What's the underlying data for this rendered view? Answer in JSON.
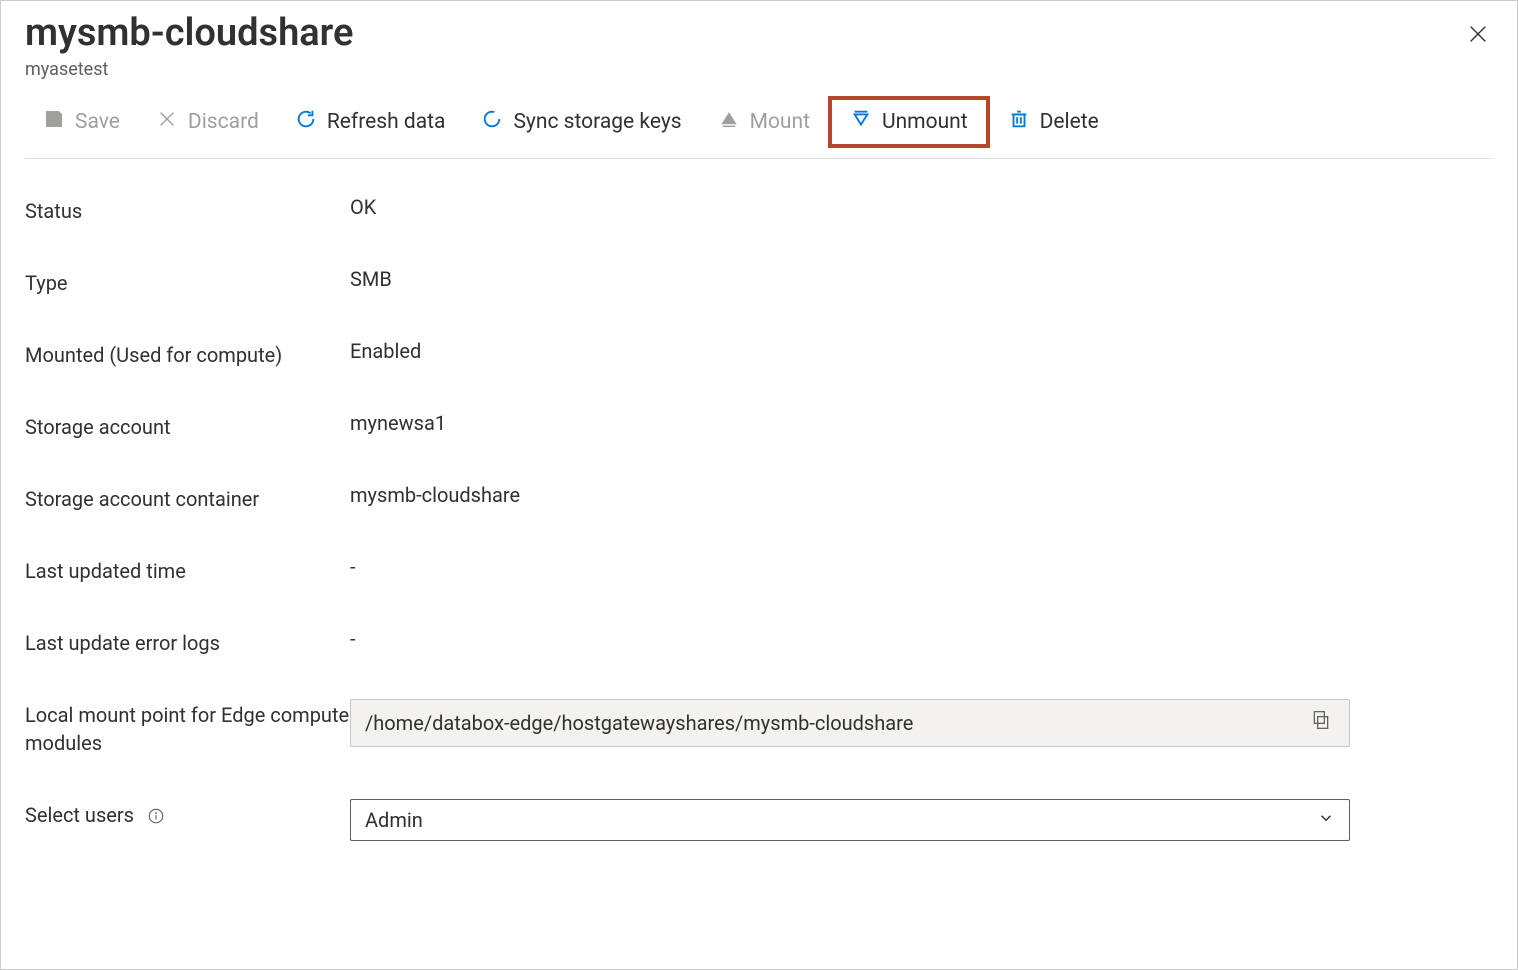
{
  "header": {
    "title": "mysmb-cloudshare",
    "subtitle": "myasetest"
  },
  "toolbar": {
    "save": "Save",
    "discard": "Discard",
    "refresh": "Refresh data",
    "sync": "Sync storage keys",
    "mount": "Mount",
    "unmount": "Unmount",
    "delete": "Delete"
  },
  "props": {
    "status": {
      "label": "Status",
      "value": "OK"
    },
    "type": {
      "label": "Type",
      "value": "SMB"
    },
    "mounted": {
      "label": "Mounted (Used for compute)",
      "value": "Enabled"
    },
    "storage_account": {
      "label": "Storage account",
      "value": "mynewsa1"
    },
    "container": {
      "label": "Storage account container",
      "value": "mysmb-cloudshare"
    },
    "last_updated": {
      "label": "Last updated time",
      "value": "-"
    },
    "error_logs": {
      "label": "Last update error logs",
      "value": "-"
    },
    "mount_point": {
      "label": "Local mount point for Edge compute modules",
      "value": "/home/databox-edge/hostgatewayshares/mysmb-cloudshare"
    },
    "select_users": {
      "label": "Select users",
      "value": "Admin"
    }
  }
}
